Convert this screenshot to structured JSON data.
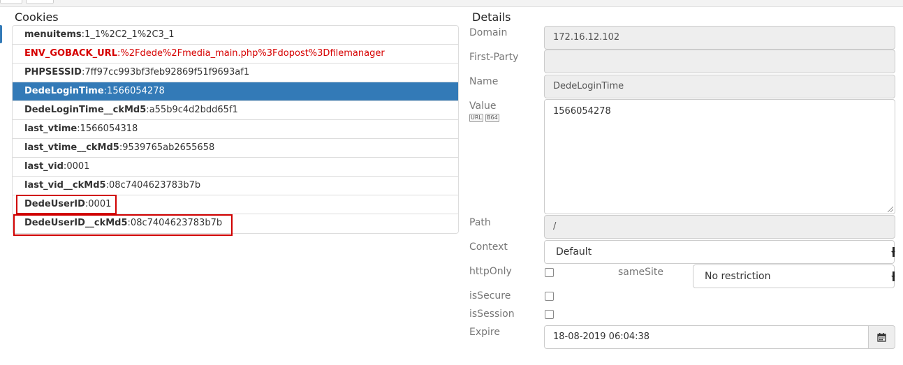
{
  "headings": {
    "cookies": "Cookies",
    "details": "Details"
  },
  "cookies": [
    {
      "name": "menuitems",
      "value": "1_1%2C2_1%2C3_1"
    },
    {
      "name": "ENV_GOBACK_URL",
      "value": "%2Fdede%2Fmedia_main.php%3Fdopost%3Dfilemanager"
    },
    {
      "name": "PHPSESSID",
      "value": "7ff97cc993bf3feb92869f51f9693af1"
    },
    {
      "name": "DedeLoginTime",
      "value": "1566054278"
    },
    {
      "name": "DedeLoginTime__ckMd5",
      "value": "a55b9c4d2bdd65f1"
    },
    {
      "name": "last_vtime",
      "value": "1566054318"
    },
    {
      "name": "last_vtime__ckMd5",
      "value": "9539765ab2655658"
    },
    {
      "name": "last_vid",
      "value": "0001"
    },
    {
      "name": "last_vid__ckMd5",
      "value": "08c7404623783b7b"
    },
    {
      "name": "DedeUserID",
      "value": "0001"
    },
    {
      "name": "DedeUserID__ckMd5",
      "value": "08c7404623783b7b"
    }
  ],
  "sep": ":",
  "selected_index": 3,
  "warning_index": 1,
  "labels": {
    "domain": "Domain",
    "first_party": "First-Party",
    "name": "Name",
    "value": "Value",
    "path": "Path",
    "context": "Context",
    "http_only": "httpOnly",
    "same_site": "sameSite",
    "is_secure": "isSecure",
    "is_session": "isSession",
    "expire": "Expire"
  },
  "value_buttons": {
    "url": "URL",
    "b64": "B64"
  },
  "details": {
    "domain": "172.16.12.102",
    "first_party": "",
    "name": "DedeLoginTime",
    "value": "1566054278",
    "path": "/",
    "context": "Default",
    "same_site": "No restriction",
    "http_only": false,
    "is_secure": false,
    "is_session": false,
    "expire": "18-08-2019 06:04:38"
  },
  "icons": {
    "calendar": "calendar-icon"
  },
  "colors": {
    "selected": "#337ab7",
    "warning_text": "#d60000",
    "highlight_box": "#d00000"
  }
}
